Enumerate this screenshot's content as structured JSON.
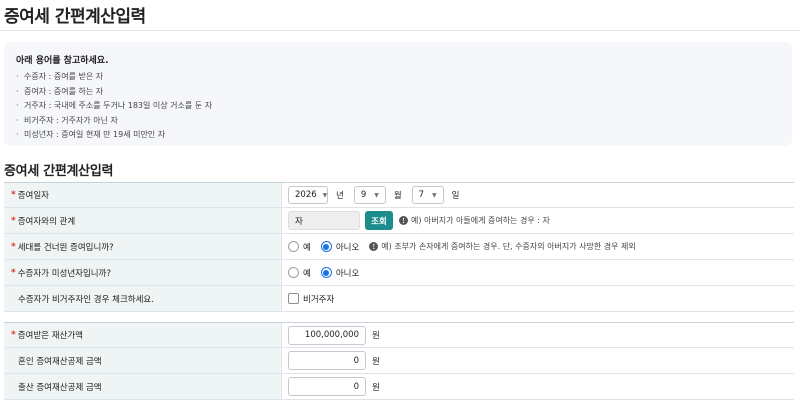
{
  "page_title": "증여세 간편계산입력",
  "notice": {
    "title": "아래 용어를 참고하세요.",
    "items": [
      "수증자 : 증여를 받은 자",
      "증여자 : 증여를 하는 자",
      "거주자 : 국내에 주소를 두거나 183일 이상 거소를 둔 자",
      "비거주자 : 거주자가 아닌 자",
      "미성년자 : 증여일 현재 만 19세 미만인 자"
    ]
  },
  "section_title": "증여세 간편계산입력",
  "form": {
    "gift_date": {
      "label": "증여일자",
      "year": "2026",
      "year_unit": "년",
      "month": "9",
      "month_unit": "월",
      "day": "7",
      "day_unit": "일"
    },
    "relation": {
      "label": "증여자와의 관계",
      "value": "자",
      "button": "조회",
      "hint": "예) 아버지가 아들에게 증여하는 경우 : 자"
    },
    "generation_skip": {
      "label": "세대를 건너뛴 증여입니까?",
      "option_yes": "예",
      "option_no": "아니오",
      "selected": "아니오",
      "hint": "예) 조부가 손자에게 증여하는 경우. 단, 수증자의 아버지가 사망한 경우 제외"
    },
    "minor": {
      "label": "수증자가 미성년자입니까?",
      "option_yes": "예",
      "option_no": "아니오",
      "selected": "아니오"
    },
    "non_resident": {
      "label": "수증자가 비거주자인 경우 체크하세요.",
      "checkbox_label": "비거주자",
      "checked": false
    },
    "gift_amount": {
      "label": "증여받은 재산가액",
      "value": "100,000,000",
      "unit": "원"
    },
    "marriage_deduction": {
      "label": "혼인 증여재산공제 금액",
      "value": "0",
      "unit": "원"
    },
    "birth_deduction": {
      "label": "출산 증여재산공제 금액",
      "value": "0",
      "unit": "원"
    }
  },
  "icons": {
    "info": "info-icon",
    "dropdown": "chevron-down-icon"
  },
  "colors": {
    "accent": "#1c8c8c",
    "required": "#d6322c",
    "radio_selected": "#1a73e8",
    "label_bg": "#eef5f4"
  }
}
